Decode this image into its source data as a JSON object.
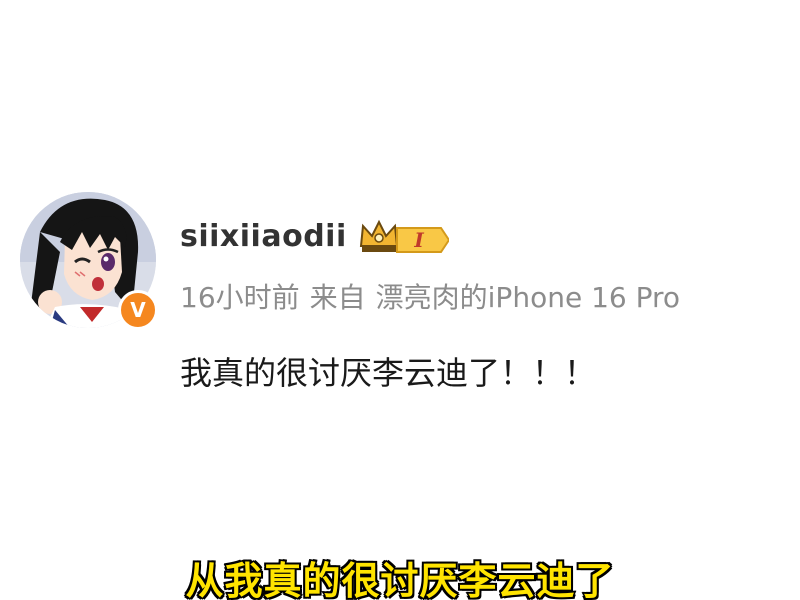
{
  "post": {
    "username": "siixiiaodii",
    "verified_mark": "V",
    "vip_level": "I",
    "time": "16小时前",
    "source_prefix": "来自",
    "device": "漂亮肉的iPhone 16 Pro",
    "text": "我真的很讨厌李云迪了！！！"
  },
  "subtitle": "从我真的很讨厌李云迪了",
  "colors": {
    "verified_orange": "#f5871f",
    "subtitle_yellow": "#ffe400",
    "meta_gray": "#8c8c8c",
    "vip_gold": "#f2b531"
  },
  "icons": {
    "verified": "verified-v-icon",
    "vip": "crown-vip-badge-icon"
  }
}
